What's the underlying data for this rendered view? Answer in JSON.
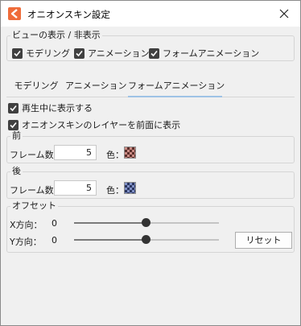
{
  "window": {
    "title": "オニオンスキン設定",
    "accent_color": "#ef6c3a"
  },
  "view_group": {
    "legend": "ビューの表示 / 非表示",
    "checkboxes": [
      {
        "label": "モデリング",
        "checked": true
      },
      {
        "label": "アニメーション",
        "checked": true
      },
      {
        "label": "フォームアニメーション",
        "checked": true
      }
    ]
  },
  "tabs": [
    {
      "label": "モデリング",
      "active": false
    },
    {
      "label": "アニメーション",
      "active": false
    },
    {
      "label": "フォームアニメーション",
      "active": true
    }
  ],
  "options": [
    {
      "label": "再生中に表示する",
      "checked": true
    },
    {
      "label": "オニオンスキンのレイヤーを前面に表示",
      "checked": true
    }
  ],
  "before_group": {
    "legend": "前",
    "frames_label": "フレーム数：",
    "frames_value": "5",
    "color_label": "色：",
    "color": "#c98a83"
  },
  "after_group": {
    "legend": "後",
    "frames_label": "フレーム数：",
    "frames_value": "5",
    "color_label": "色：",
    "color": "#7f8fc4"
  },
  "offset_group": {
    "legend": "オフセット",
    "x_label": "X方向：",
    "x_value": "0",
    "y_label": "Y方向：",
    "y_value": "0",
    "x_slider_fraction": 0.5,
    "y_slider_fraction": 0.5,
    "reset_label": "リセット"
  }
}
